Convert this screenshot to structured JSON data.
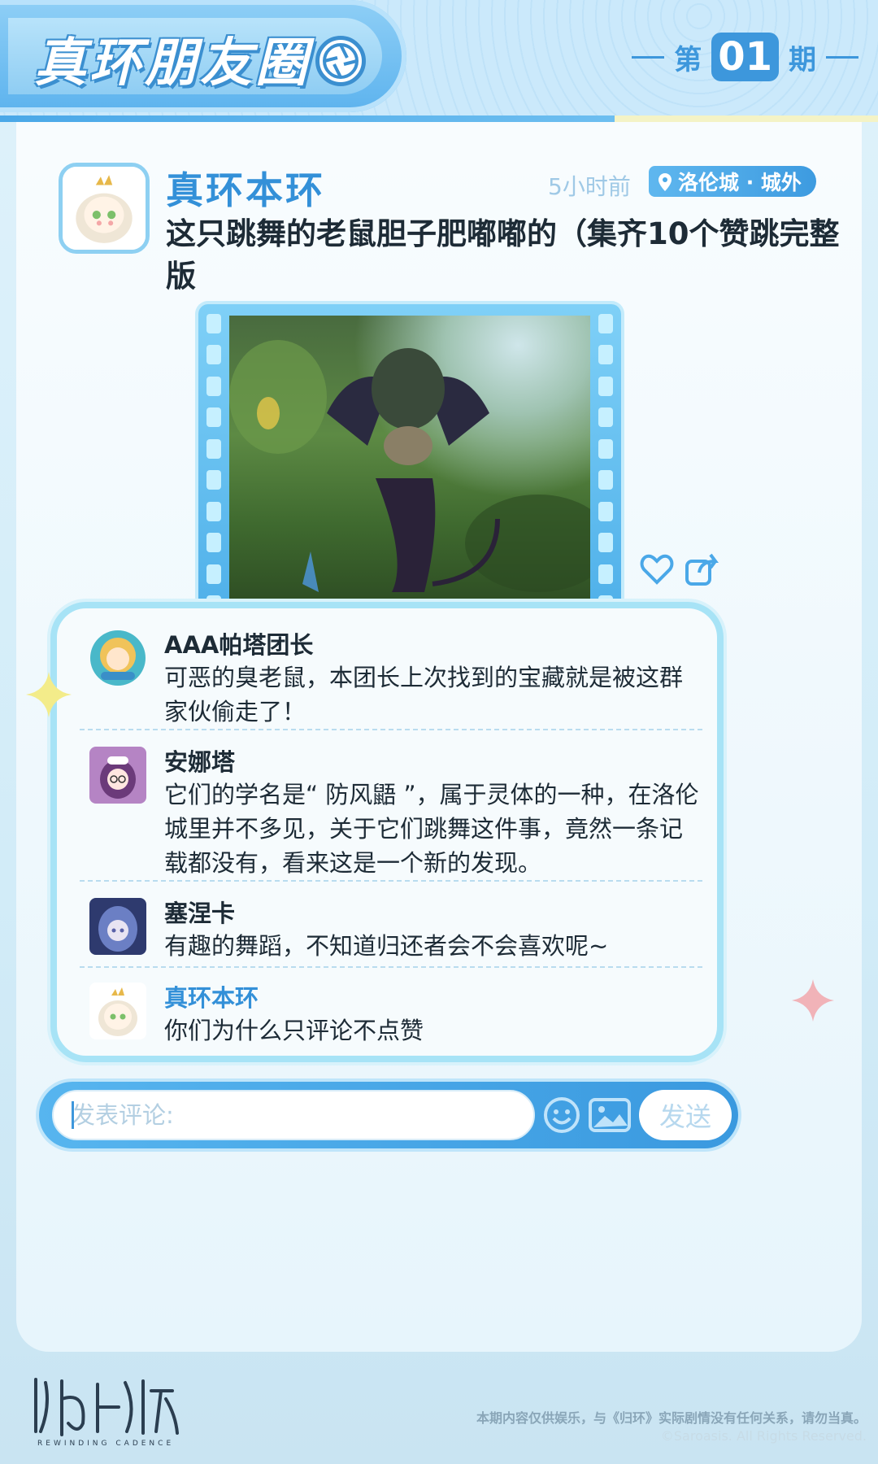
{
  "header": {
    "app_title": "真环朋友圈",
    "issue_prefix": "第",
    "issue_number": "01",
    "issue_suffix": "期",
    "icon": "camera-shutter-icon"
  },
  "post": {
    "author": "真环本环",
    "time": "5小时前",
    "location": "洛伦城 · 城外",
    "text": "这只跳舞的老鼠胆子肥嘟嘟的（集齐10个赞跳完整版",
    "media_icon": "video-frame",
    "actions": [
      "heart-icon",
      "share-icon"
    ]
  },
  "comments": [
    {
      "name": "AAA帕塔团长",
      "text": "可恶的臭老鼠，本团长上次找到的宝藏就是被这群家伙偷走了！"
    },
    {
      "name": "安娜塔",
      "text": "它们的学名是“ 防风鼯 ”，属于灵体的一种，在洛伦城里并不多见，关于它们跳舞这件事，竟然一条记载都没有，看来这是一个新的发现。"
    },
    {
      "name": "塞涅卡",
      "text": "有趣的舞蹈，不知道归还者会不会喜欢呢~"
    },
    {
      "name": "真环本环",
      "text": "你们为什么只评论不点赞"
    }
  ],
  "composer": {
    "placeholder": "发表评论:",
    "send_label": "发送",
    "icons": [
      "emoji-icon",
      "image-icon"
    ]
  },
  "footer": {
    "logo_text": "归环",
    "logo_sub": "REWINDING CADENCE",
    "disclaimer": "本期内容仅供娱乐，与《归环》实际剧情没有任何关系，请勿当真。",
    "copyright": "©Saroasis. All Rights Reserved."
  },
  "colors": {
    "accent": "#3d97dc",
    "accent_light": "#8fcff6",
    "name_blue": "#3390d8",
    "text_dark": "#1d2b36"
  }
}
